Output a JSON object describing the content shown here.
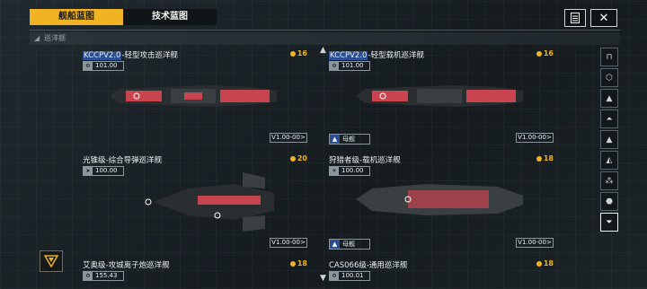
{
  "tabs": [
    {
      "label": "舰船蓝图",
      "active": true
    },
    {
      "label": "技术蓝图",
      "active": false
    }
  ],
  "top_buttons": {
    "list_icon": "document-list-icon",
    "close_icon": "close-icon"
  },
  "section": {
    "label": "巡洋舰"
  },
  "cards": [
    {
      "title_hl": "KCCPV2.0",
      "title_rest": "-轻型攻击巡洋舰",
      "score": "16",
      "stat": "101.00",
      "version": "V1.00-00>",
      "badge": null
    },
    {
      "title_hl": "KCCPV2.0",
      "title_rest": "-轻型载机巡洋舰",
      "score": "16",
      "stat": "101.00",
      "version": "V1.00-00>",
      "badge": "母舰"
    },
    {
      "title_hl": "",
      "title_rest": "光锥级-综合导弹巡洋舰",
      "score": "20",
      "stat": "100.00",
      "version": "V1.00-00>",
      "badge": null
    },
    {
      "title_hl": "",
      "title_rest": "狩猎者级-载机巡洋舰",
      "score": "18",
      "stat": "100.00",
      "version": "V1.00-00>",
      "badge": "母舰"
    },
    {
      "title_hl": "",
      "title_rest": "艾奥级-攻城离子炮巡洋舰",
      "score": "18",
      "stat": "155.43",
      "version": "",
      "badge": null
    },
    {
      "title_hl": "",
      "title_rest": "CAS066级-通用巡洋舰",
      "score": "18",
      "stat": "100.01",
      "version": "",
      "badge": null
    }
  ],
  "sidebar": [
    "frigate-icon",
    "destroyer-icon",
    "cruiser-icon",
    "battlecruiser-icon",
    "carrier-icon",
    "auxiliary-icon",
    "formation-icon",
    "station-icon",
    "filter-icon"
  ],
  "colors": {
    "accent": "#f0b323",
    "highlight": "#2c4f93",
    "ship_red": "#c8454f"
  }
}
